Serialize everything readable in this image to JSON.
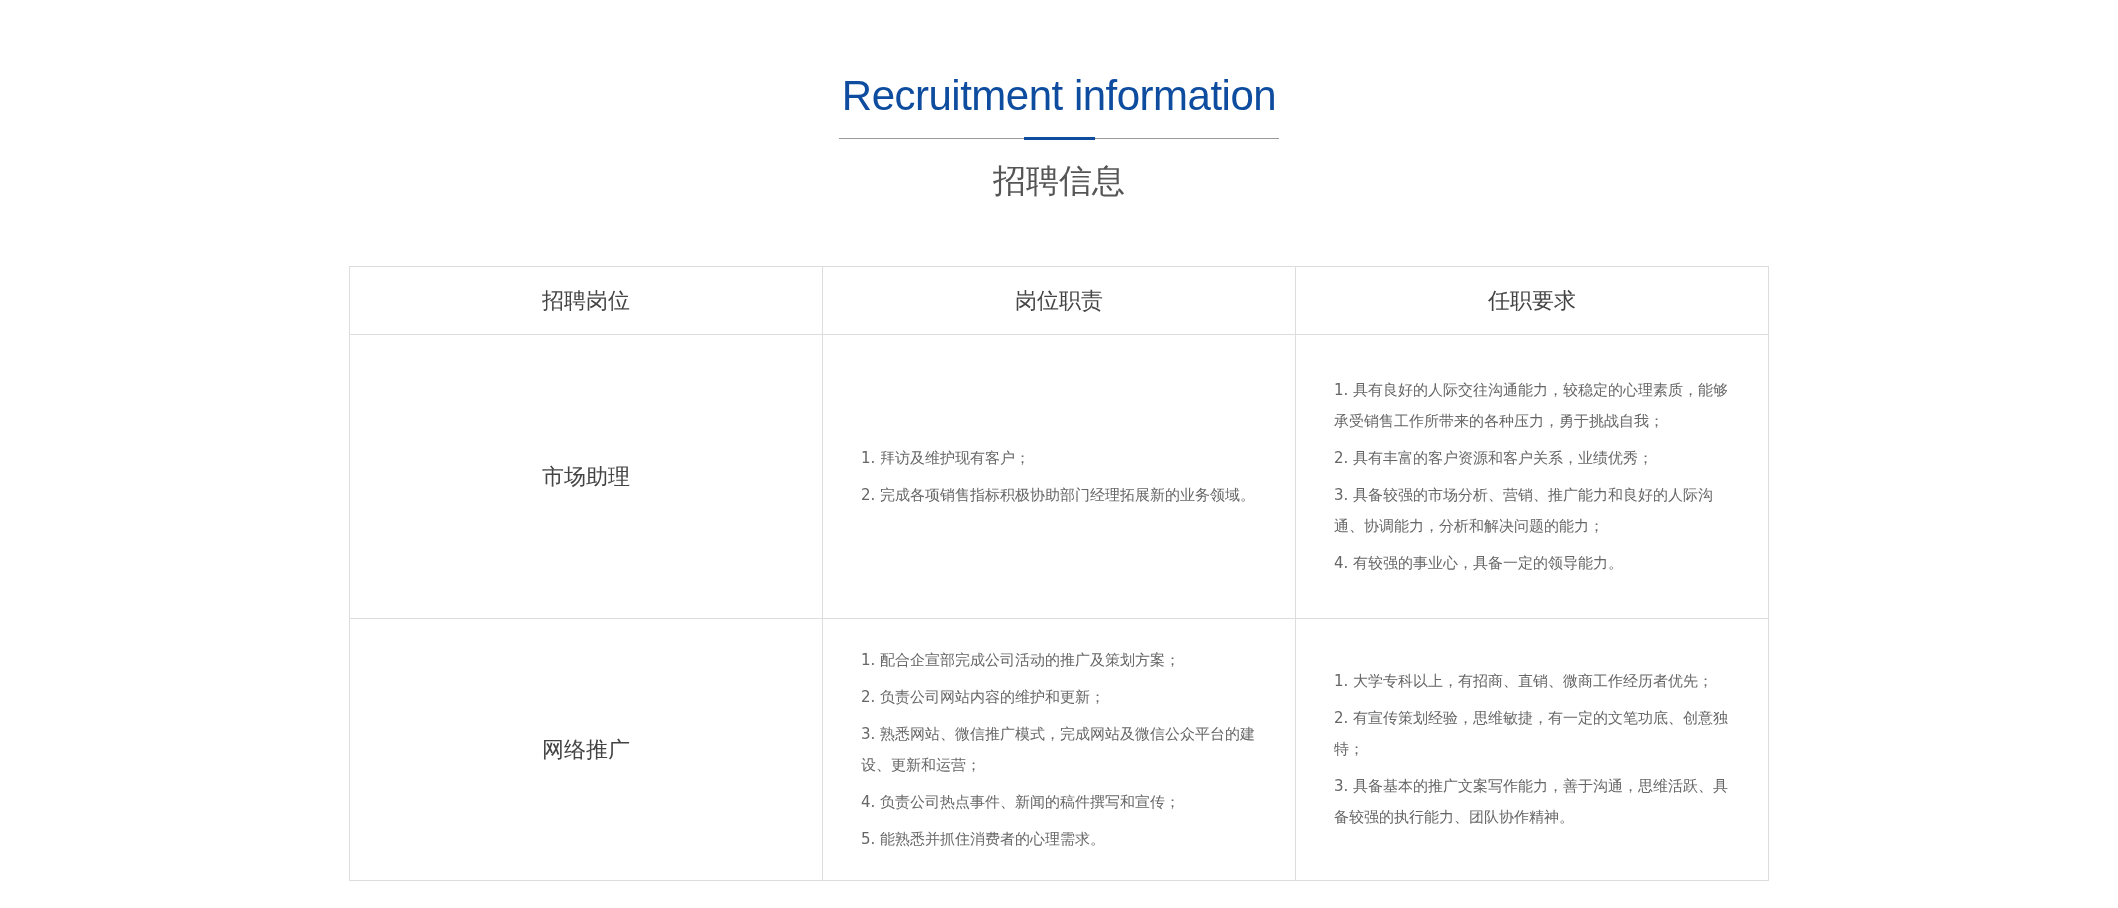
{
  "heading": {
    "title": "Recruitment information",
    "subtitle": "招聘信息"
  },
  "table": {
    "columns": [
      "招聘岗位",
      "岗位职责",
      "任职要求"
    ],
    "rows": [
      {
        "position": "市场助理",
        "duties": [
          "1. 拜访及维护现有客户；",
          "2. 完成各项销售指标积极协助部门经理拓展新的业务领域。"
        ],
        "requirements": [
          "1.  具有良好的人际交往沟通能力，较稳定的心理素质，能够承受销售工作所带来的各种压力，勇于挑战自我；",
          "2. 具有丰富的客户资源和客户关系，业绩优秀；",
          "3.  具备较强的市场分析、营销、推广能力和良好的人际沟通、协调能力，分析和解决问题的能力；",
          "4. 有较强的事业心，具备一定的领导能力。"
        ]
      },
      {
        "position": "网络推广",
        "duties": [
          "1. 配合企宣部完成公司活动的推广及策划方案；",
          "2. 负责公司网站内容的维护和更新；",
          "3. 熟悉网站、微信推广模式，完成网站及微信公众平台的建设、更新和运营；",
          "4. 负责公司热点事件、新闻的稿件撰写和宣传；",
          "5. 能熟悉并抓住消费者的心理需求。"
        ],
        "requirements": [
          "1. 大学专科以上，有招商、直销、微商工作经历者优先；",
          "2. 有宣传策划经验，思维敏捷，有一定的文笔功底、创意独特；",
          "3. 具备基本的推广文案写作能力，善于沟通，思维活跃、具备较强的执行能力、团队协作精神。"
        ]
      }
    ]
  }
}
